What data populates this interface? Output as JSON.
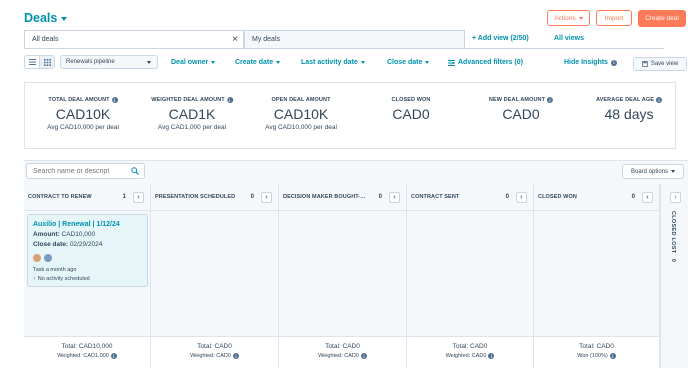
{
  "header": {
    "title": "Deals",
    "actions_label": "Actions",
    "import_label": "Import",
    "create_label": "Create deal"
  },
  "views": {
    "tabs": [
      {
        "label": "All deals",
        "active": true
      },
      {
        "label": "My deals",
        "active": false
      }
    ],
    "add_view": "+ Add view (2/50)",
    "all_views": "All views"
  },
  "toolbar": {
    "pipeline": "Renewals pipeline",
    "filters": [
      "Deal owner",
      "Create date",
      "Last activity date",
      "Close date"
    ],
    "advanced_filters": "Advanced filters (0)",
    "hide_insights": "Hide Insights",
    "save_view": "Save view"
  },
  "summary": [
    {
      "label": "TOTAL DEAL AMOUNT",
      "value": "CAD10K",
      "sub": "Avg CAD10,000 per deal",
      "info": true
    },
    {
      "label": "WEIGHTED DEAL AMOUNT",
      "value": "CAD1K",
      "sub": "Avg CAD1,000 per deal",
      "info": true
    },
    {
      "label": "OPEN DEAL AMOUNT",
      "value": "CAD10K",
      "sub": "Avg CAD10,000 per deal",
      "info": false
    },
    {
      "label": "CLOSED WON",
      "value": "CAD0",
      "sub": "",
      "info": false
    },
    {
      "label": "NEW DEAL AMOUNT",
      "value": "CAD0",
      "sub": "",
      "info": true
    },
    {
      "label": "AVERAGE DEAL AGE",
      "value": "48 days",
      "sub": "",
      "info": true
    }
  ],
  "board": {
    "search_placeholder": "Search name or descript",
    "options_label": "Board options",
    "columns": [
      {
        "name": "CONTRACT TO RENEW",
        "count": "1",
        "total": "Total: CAD10,000",
        "weighted": "Weighted: CAD1,000"
      },
      {
        "name": "PRESENTATION SCHEDULED",
        "count": "0",
        "total": "Total: CAD0",
        "weighted": "Weighted: CAD0"
      },
      {
        "name": "DECISION MAKER BOUGHT-...",
        "count": "0",
        "total": "Total: CAD0",
        "weighted": "Weighted: CAD0"
      },
      {
        "name": "CONTRACT SENT",
        "count": "0",
        "total": "Total: CAD0",
        "weighted": "Weighted: CAD0"
      },
      {
        "name": "CLOSED WON",
        "count": "0",
        "total": "Total: CAD0",
        "weighted": "Won (100%)"
      }
    ],
    "collapsed_column": "CLOSED LOST",
    "collapsed_count": "0",
    "card": {
      "title": "Auxilio | Renewal | 1/12/24",
      "amount_label": "Amount:",
      "amount_value": "CAD10,000",
      "close_label": "Close date:",
      "close_value": "02/29/2024",
      "task": "Task a month ago",
      "activity": "No activity scheduled",
      "avatar_colors": [
        "#d9a07a",
        "#7b9bbf"
      ]
    }
  },
  "colors": {
    "accent": "#ff7a59",
    "link": "#0091ae",
    "text": "#33475b",
    "card_bg": "#e5f5f8"
  }
}
